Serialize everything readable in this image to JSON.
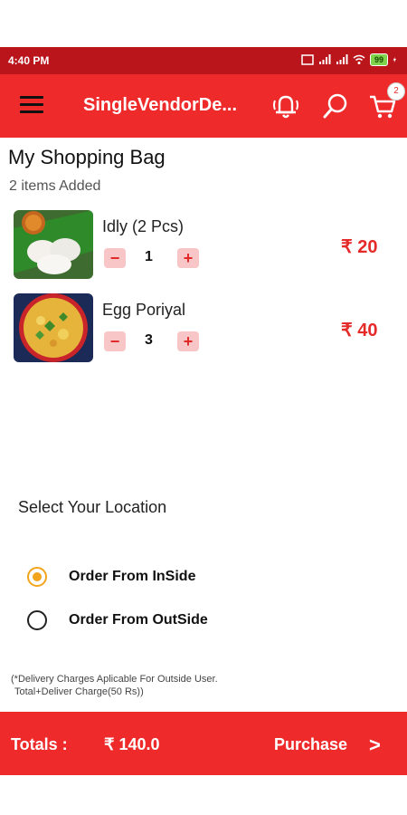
{
  "status_bar": {
    "time": "4:40 PM",
    "battery": "99"
  },
  "app_bar": {
    "title": "SingleVendorDe...",
    "cart_count": "2"
  },
  "page": {
    "title": "My Shopping Bag",
    "items_count": "2 items Added"
  },
  "items": [
    {
      "name": "Idly (2 Pcs)",
      "qty": "1",
      "price": "₹ 20",
      "minus": "−",
      "plus": "+"
    },
    {
      "name": "Egg Poriyal",
      "qty": "3",
      "price": "₹ 40",
      "minus": "−",
      "plus": "+"
    }
  ],
  "location": {
    "title": "Select Your Location",
    "options": [
      {
        "label": "Order From InSide",
        "selected": true
      },
      {
        "label": "Order From OutSide",
        "selected": false
      }
    ]
  },
  "note": {
    "line1": "(*Delivery Charges Aplicable For Outside User.",
    "line2": "Total+Deliver Charge(50 Rs))"
  },
  "footer": {
    "totals_label": "Totals :",
    "totals_value": "₹ 140.0",
    "purchase_label": "Purchase",
    "chevron": ">"
  },
  "colors": {
    "primary": "#ee2a2b",
    "status": "#b9151b",
    "accent": "#f2a41b"
  }
}
